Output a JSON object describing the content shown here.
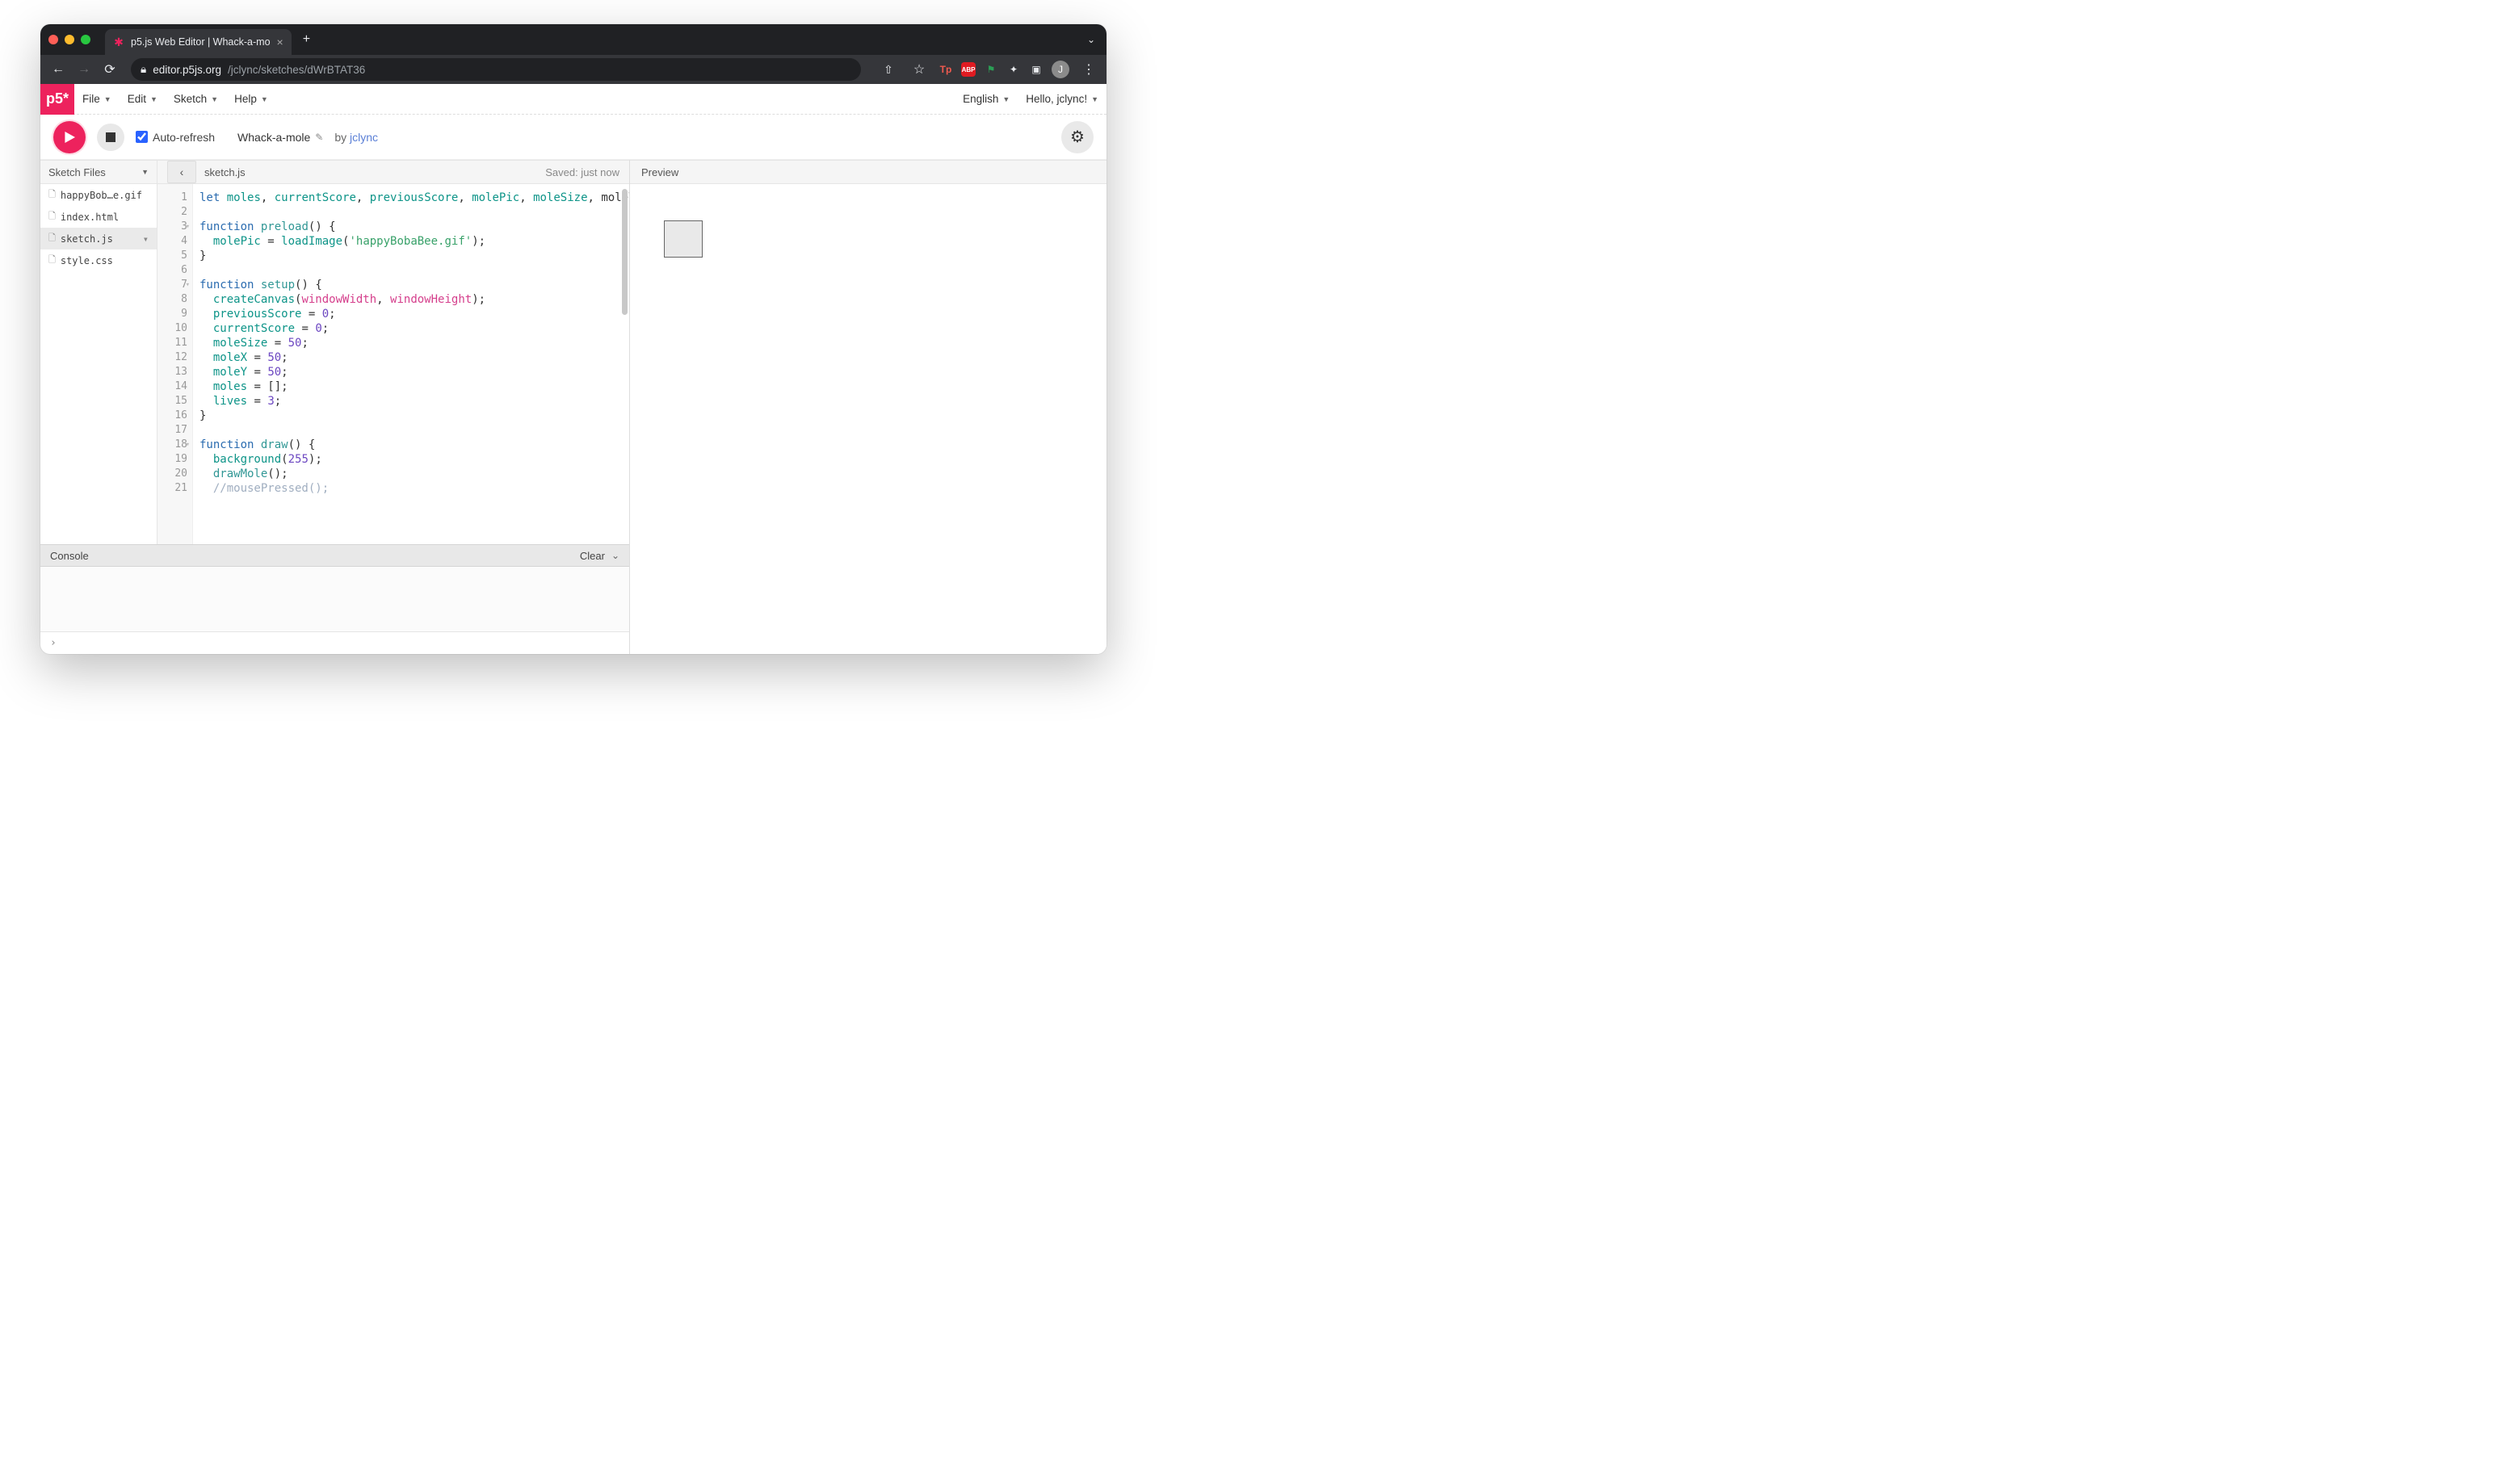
{
  "browser": {
    "tab_title": "p5.js Web Editor | Whack-a-mo",
    "url_host": "editor.p5js.org",
    "url_path": "/jclync/sketches/dWrBTAT36",
    "profile_initial": "J"
  },
  "menu": {
    "logo": "p5*",
    "file": "File",
    "edit": "Edit",
    "sketch": "Sketch",
    "help": "Help",
    "language": "English",
    "greeting": "Hello, jclync!"
  },
  "toolbar": {
    "auto_refresh": "Auto-refresh",
    "sketch_name": "Whack-a-mole",
    "by": "by",
    "author": "jclync"
  },
  "sidebar": {
    "header": "Sketch Files",
    "files": [
      {
        "name": "happyBob…e.gif",
        "active": false
      },
      {
        "name": "index.html",
        "active": false
      },
      {
        "name": "sketch.js",
        "active": true
      },
      {
        "name": "style.css",
        "active": false
      }
    ]
  },
  "editor": {
    "filename": "sketch.js",
    "saved": "Saved: just now",
    "code_lines": [
      "let moles, currentScore, previousScore, molePic, moleSize, moleX, moleY, lives;",
      "",
      "function preload() {",
      "  molePic = loadImage('happyBobaBee.gif');",
      "}",
      "",
      "function setup() {",
      "  createCanvas(windowWidth, windowHeight);",
      "  previousScore = 0;",
      "  currentScore = 0;",
      "  moleSize = 50;",
      "  moleX = 50;",
      "  moleY = 50;",
      "  moles = [];",
      "  lives = 3;",
      "}",
      "",
      "function draw() {",
      "  background(255);",
      "  drawMole();",
      "  //mousePressed();"
    ],
    "visual_line_count": 21,
    "fold_lines": [
      3,
      7,
      18
    ]
  },
  "console": {
    "header": "Console",
    "clear": "Clear",
    "prompt": "›"
  },
  "preview": {
    "header": "Preview"
  }
}
